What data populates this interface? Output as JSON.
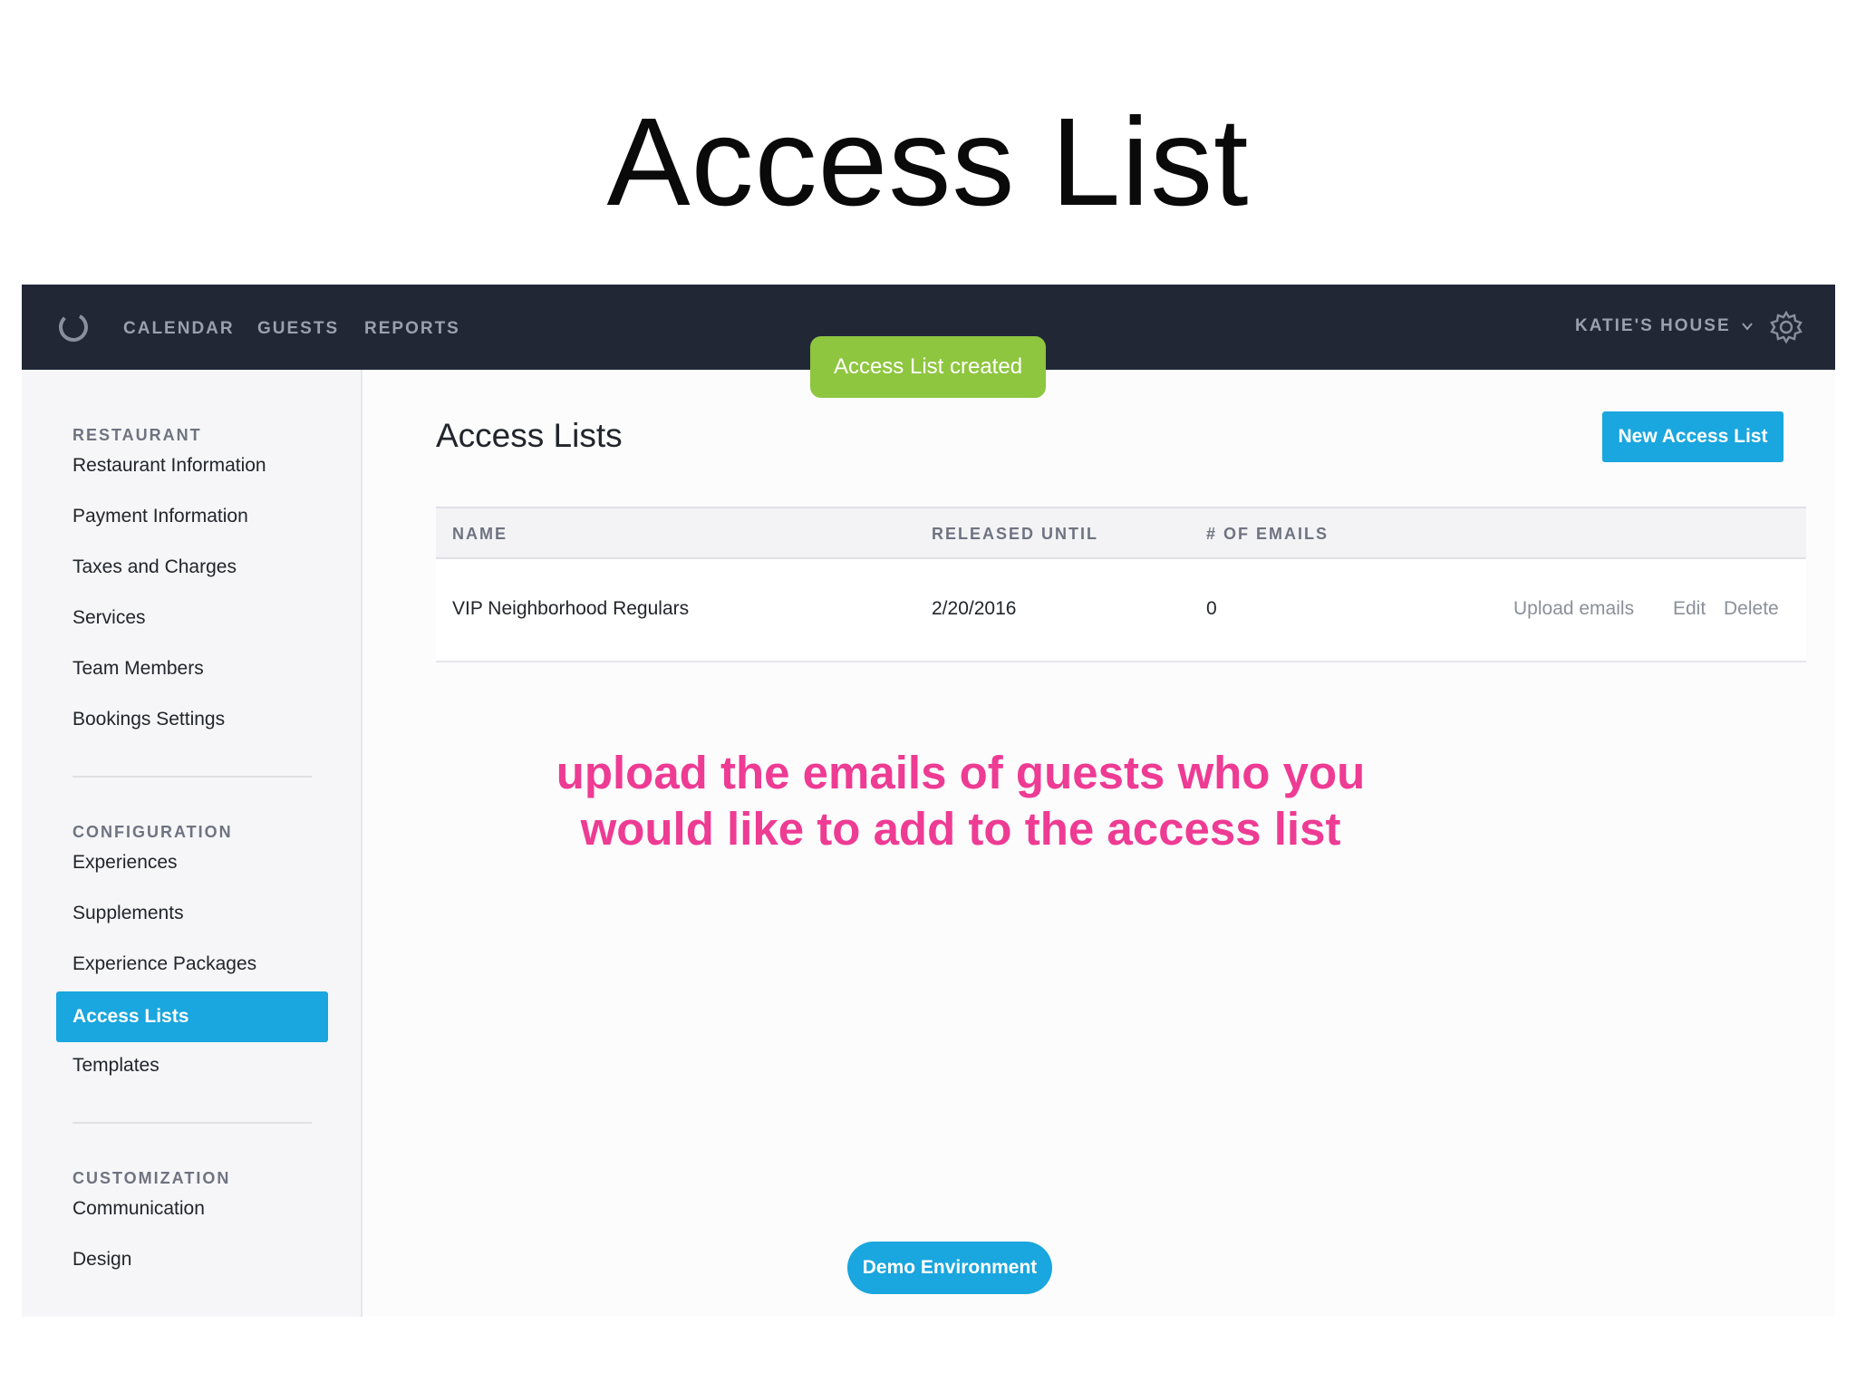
{
  "slide": {
    "title": "Access List"
  },
  "topbar": {
    "nav": [
      "CALENDAR",
      "GUESTS",
      "REPORTS"
    ],
    "account": "KATIE'S HOUSE",
    "icons": {
      "logo": "logo-ring-icon",
      "chevron": "chevron-down-icon",
      "settings": "gear-icon"
    }
  },
  "toast": {
    "message": "Access List created",
    "color": "#8ec63f"
  },
  "sidebar": {
    "sections": [
      {
        "heading": "RESTAURANT",
        "items": [
          "Restaurant Information",
          "Payment Information",
          "Taxes and Charges",
          "Services",
          "Team Members",
          "Bookings Settings"
        ]
      },
      {
        "heading": "CONFIGURATION",
        "items": [
          "Experiences",
          "Supplements",
          "Experience Packages",
          "Access Lists",
          "Templates"
        ]
      },
      {
        "heading": "CUSTOMIZATION",
        "items": [
          "Communication",
          "Design"
        ]
      }
    ],
    "active_item": "Access Lists"
  },
  "main": {
    "title": "Access Lists",
    "new_button": "New Access List",
    "table": {
      "headers": [
        "NAME",
        "RELEASED UNTIL",
        "# OF EMAILS"
      ],
      "rows": [
        {
          "name": "VIP Neighborhood Regulars",
          "released_until": "2/20/2016",
          "emails": "0",
          "actions": [
            "Upload emails",
            "Edit",
            "Delete"
          ]
        }
      ]
    },
    "annotation": "upload the emails of guests who you would like to add to the access list",
    "demo_button": "Demo Environment"
  },
  "colors": {
    "accent": "#1aa6de",
    "topbar": "#222736",
    "annotation": "#ee3b93"
  }
}
